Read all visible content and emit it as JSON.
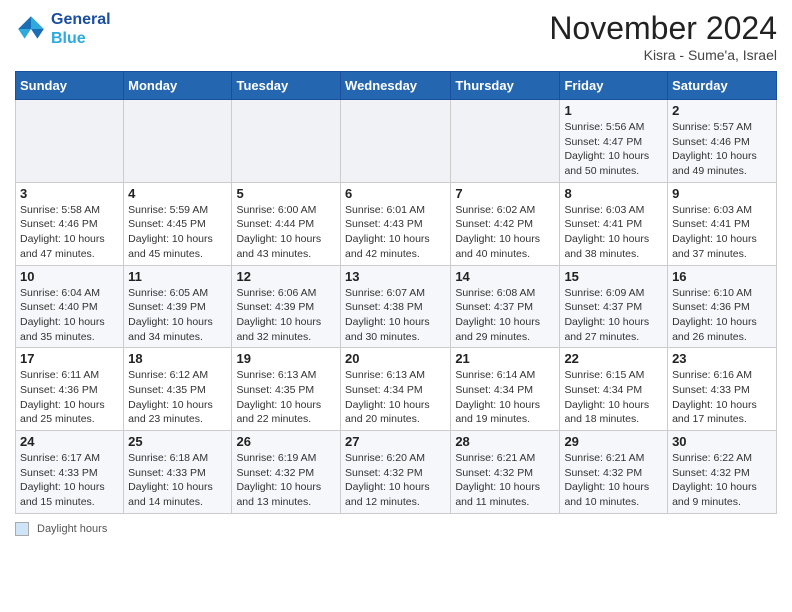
{
  "header": {
    "logo_line1": "General",
    "logo_line2": "Blue",
    "month": "November 2024",
    "location": "Kisra - Sume'a, Israel"
  },
  "weekdays": [
    "Sunday",
    "Monday",
    "Tuesday",
    "Wednesday",
    "Thursday",
    "Friday",
    "Saturday"
  ],
  "legend_label": "Daylight hours",
  "weeks": [
    [
      {
        "day": "",
        "info": ""
      },
      {
        "day": "",
        "info": ""
      },
      {
        "day": "",
        "info": ""
      },
      {
        "day": "",
        "info": ""
      },
      {
        "day": "",
        "info": ""
      },
      {
        "day": "1",
        "info": "Sunrise: 5:56 AM\nSunset: 4:47 PM\nDaylight: 10 hours\nand 50 minutes."
      },
      {
        "day": "2",
        "info": "Sunrise: 5:57 AM\nSunset: 4:46 PM\nDaylight: 10 hours\nand 49 minutes."
      }
    ],
    [
      {
        "day": "3",
        "info": "Sunrise: 5:58 AM\nSunset: 4:46 PM\nDaylight: 10 hours\nand 47 minutes."
      },
      {
        "day": "4",
        "info": "Sunrise: 5:59 AM\nSunset: 4:45 PM\nDaylight: 10 hours\nand 45 minutes."
      },
      {
        "day": "5",
        "info": "Sunrise: 6:00 AM\nSunset: 4:44 PM\nDaylight: 10 hours\nand 43 minutes."
      },
      {
        "day": "6",
        "info": "Sunrise: 6:01 AM\nSunset: 4:43 PM\nDaylight: 10 hours\nand 42 minutes."
      },
      {
        "day": "7",
        "info": "Sunrise: 6:02 AM\nSunset: 4:42 PM\nDaylight: 10 hours\nand 40 minutes."
      },
      {
        "day": "8",
        "info": "Sunrise: 6:03 AM\nSunset: 4:41 PM\nDaylight: 10 hours\nand 38 minutes."
      },
      {
        "day": "9",
        "info": "Sunrise: 6:03 AM\nSunset: 4:41 PM\nDaylight: 10 hours\nand 37 minutes."
      }
    ],
    [
      {
        "day": "10",
        "info": "Sunrise: 6:04 AM\nSunset: 4:40 PM\nDaylight: 10 hours\nand 35 minutes."
      },
      {
        "day": "11",
        "info": "Sunrise: 6:05 AM\nSunset: 4:39 PM\nDaylight: 10 hours\nand 34 minutes."
      },
      {
        "day": "12",
        "info": "Sunrise: 6:06 AM\nSunset: 4:39 PM\nDaylight: 10 hours\nand 32 minutes."
      },
      {
        "day": "13",
        "info": "Sunrise: 6:07 AM\nSunset: 4:38 PM\nDaylight: 10 hours\nand 30 minutes."
      },
      {
        "day": "14",
        "info": "Sunrise: 6:08 AM\nSunset: 4:37 PM\nDaylight: 10 hours\nand 29 minutes."
      },
      {
        "day": "15",
        "info": "Sunrise: 6:09 AM\nSunset: 4:37 PM\nDaylight: 10 hours\nand 27 minutes."
      },
      {
        "day": "16",
        "info": "Sunrise: 6:10 AM\nSunset: 4:36 PM\nDaylight: 10 hours\nand 26 minutes."
      }
    ],
    [
      {
        "day": "17",
        "info": "Sunrise: 6:11 AM\nSunset: 4:36 PM\nDaylight: 10 hours\nand 25 minutes."
      },
      {
        "day": "18",
        "info": "Sunrise: 6:12 AM\nSunset: 4:35 PM\nDaylight: 10 hours\nand 23 minutes."
      },
      {
        "day": "19",
        "info": "Sunrise: 6:13 AM\nSunset: 4:35 PM\nDaylight: 10 hours\nand 22 minutes."
      },
      {
        "day": "20",
        "info": "Sunrise: 6:13 AM\nSunset: 4:34 PM\nDaylight: 10 hours\nand 20 minutes."
      },
      {
        "day": "21",
        "info": "Sunrise: 6:14 AM\nSunset: 4:34 PM\nDaylight: 10 hours\nand 19 minutes."
      },
      {
        "day": "22",
        "info": "Sunrise: 6:15 AM\nSunset: 4:34 PM\nDaylight: 10 hours\nand 18 minutes."
      },
      {
        "day": "23",
        "info": "Sunrise: 6:16 AM\nSunset: 4:33 PM\nDaylight: 10 hours\nand 17 minutes."
      }
    ],
    [
      {
        "day": "24",
        "info": "Sunrise: 6:17 AM\nSunset: 4:33 PM\nDaylight: 10 hours\nand 15 minutes."
      },
      {
        "day": "25",
        "info": "Sunrise: 6:18 AM\nSunset: 4:33 PM\nDaylight: 10 hours\nand 14 minutes."
      },
      {
        "day": "26",
        "info": "Sunrise: 6:19 AM\nSunset: 4:32 PM\nDaylight: 10 hours\nand 13 minutes."
      },
      {
        "day": "27",
        "info": "Sunrise: 6:20 AM\nSunset: 4:32 PM\nDaylight: 10 hours\nand 12 minutes."
      },
      {
        "day": "28",
        "info": "Sunrise: 6:21 AM\nSunset: 4:32 PM\nDaylight: 10 hours\nand 11 minutes."
      },
      {
        "day": "29",
        "info": "Sunrise: 6:21 AM\nSunset: 4:32 PM\nDaylight: 10 hours\nand 10 minutes."
      },
      {
        "day": "30",
        "info": "Sunrise: 6:22 AM\nSunset: 4:32 PM\nDaylight: 10 hours\nand 9 minutes."
      }
    ]
  ]
}
